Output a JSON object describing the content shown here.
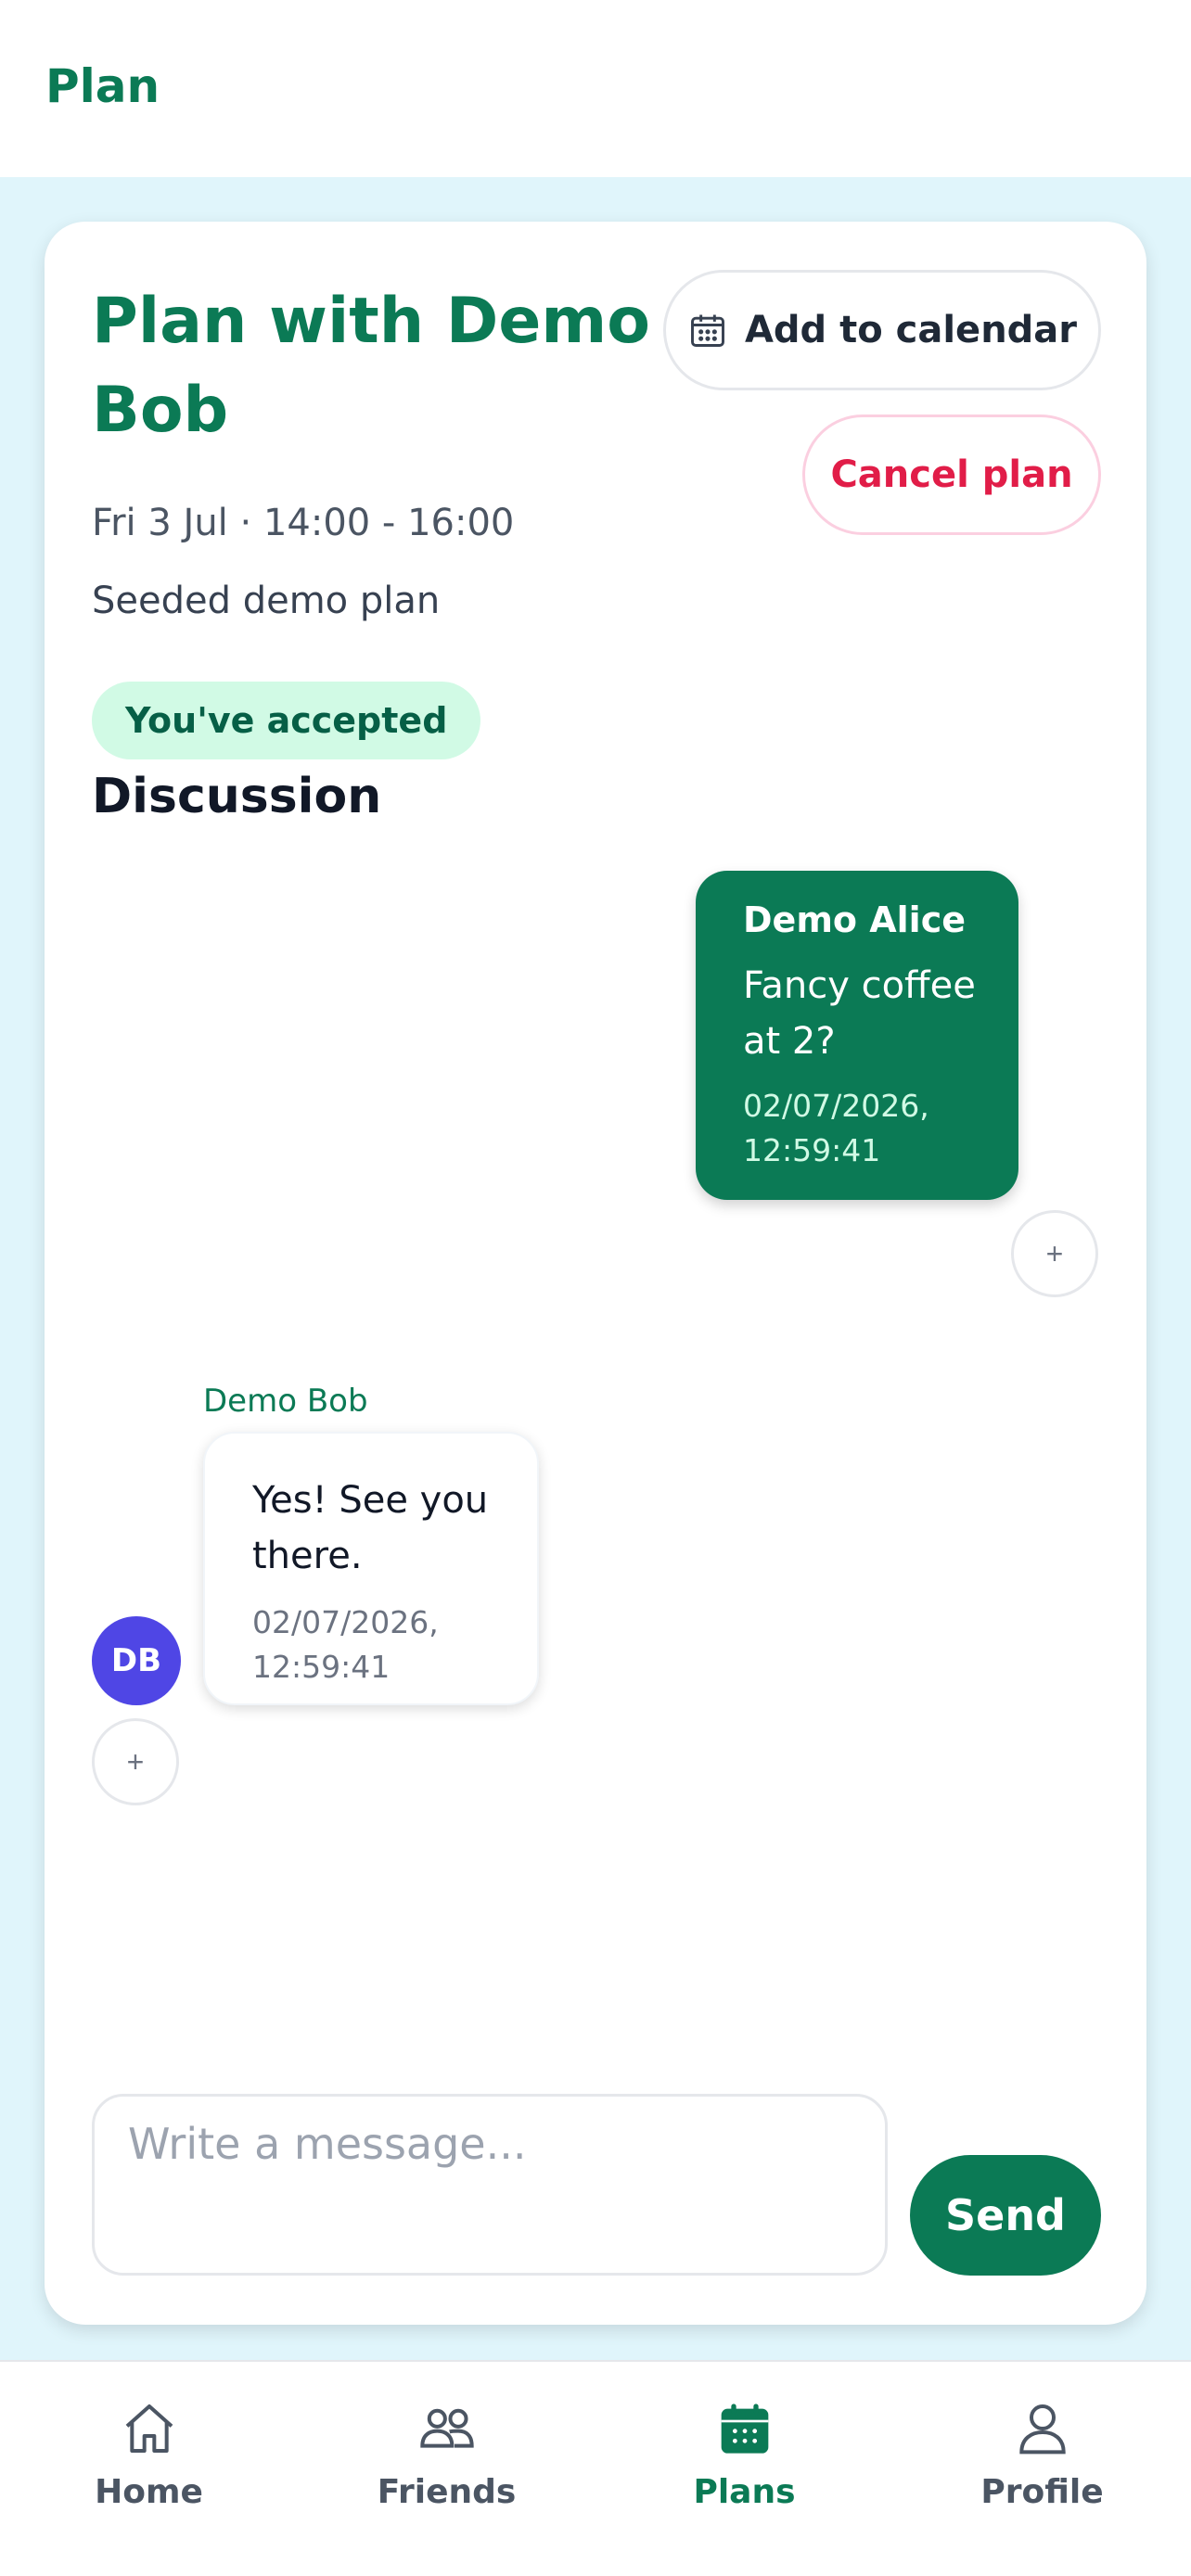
{
  "header": {
    "title": "Plan"
  },
  "plan": {
    "title": "Plan with Demo Bob",
    "datetime": "Fri 3 Jul · 14:00 - 16:00",
    "description": "Seeded demo plan",
    "status_badge": "You've accepted",
    "add_to_calendar_label": "Add to calendar",
    "cancel_label": "Cancel plan"
  },
  "discussion": {
    "title": "Discussion",
    "messages": [
      {
        "sender": "Demo Alice",
        "text": "Fancy coffee at 2?",
        "time": "02/07/2026, 12:59:41",
        "own": true,
        "react_label": "+"
      },
      {
        "sender": "Demo Bob",
        "text": "Yes! See you there.",
        "time": "02/07/2026, 12:59:41",
        "own": false,
        "avatar_initials": "DB",
        "react_label": "+"
      }
    ]
  },
  "composer": {
    "placeholder": "Write a message...",
    "value": "",
    "send_label": "Send"
  },
  "bottom_nav": [
    {
      "label": "Home",
      "icon": "home-icon",
      "active": false
    },
    {
      "label": "Friends",
      "icon": "friends-icon",
      "active": false
    },
    {
      "label": "Plans",
      "icon": "calendar-icon",
      "active": true
    },
    {
      "label": "Profile",
      "icon": "profile-icon",
      "active": false
    }
  ],
  "colors": {
    "brand": "#0b7a55",
    "danger": "#e11d48",
    "accepted_bg": "#d1fae5",
    "avatar": "#4f46e5",
    "page_bg": "#e0f5fb"
  }
}
